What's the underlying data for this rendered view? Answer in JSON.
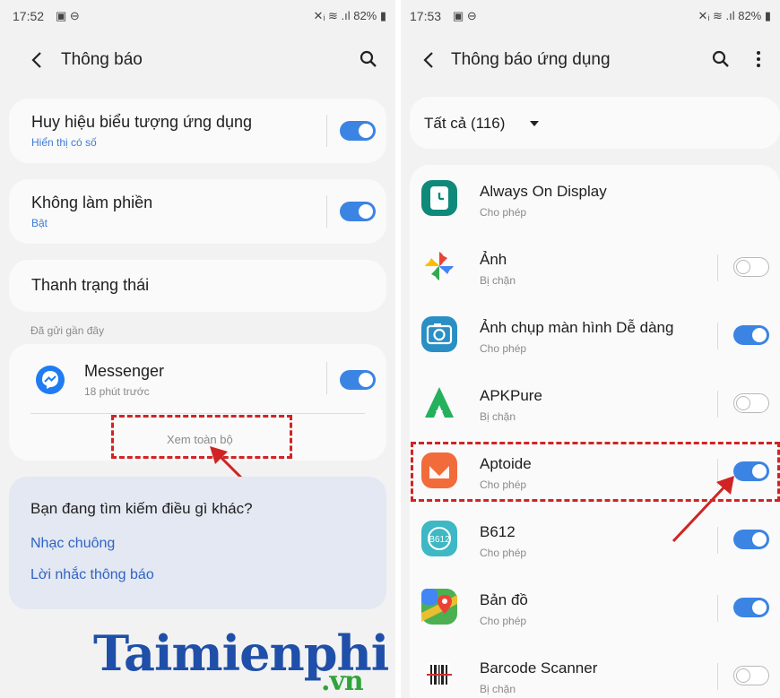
{
  "colors": {
    "accent": "#3b84e4",
    "link": "#2f63c4",
    "highlight": "#d02424",
    "toggle_off": "#b8b8b8"
  },
  "left": {
    "status": {
      "time": "17:52",
      "icons": "▣ ⊖",
      "right": "✕ᵢ ≋ .ıl 82% ▮"
    },
    "title": "Thông báo",
    "back_icon": "chevron-left-icon",
    "search_icon": "search-icon",
    "items": [
      {
        "title": "Huy hiệu biểu tượng ứng dụng",
        "subtitle": "Hiển thị có số",
        "on": true
      },
      {
        "title": "Không làm phiền",
        "subtitle": "Bật",
        "on": true
      },
      {
        "title": "Thanh trạng thái"
      }
    ],
    "section_header": "Đã gửi gần đây",
    "recent": {
      "name": "Messenger",
      "time": "18 phút trước",
      "on": true
    },
    "see_all": "Xem toàn bộ",
    "suggest": {
      "title": "Bạn đang tìm kiếm điều gì khác?",
      "links": [
        "Nhạc chuông",
        "Lời nhắc thông báo"
      ]
    },
    "watermark": {
      "brand": "Taimienphi",
      "domain": ".vn"
    }
  },
  "right": {
    "status": {
      "time": "17:53",
      "icons": "▣ ⊖",
      "right": "✕ᵢ ≋ .ıl 82% ▮"
    },
    "title": "Thông báo ứng dụng",
    "filter": "Tất cả (116)",
    "apps": [
      {
        "name": "Always On Display",
        "status": "Cho phép",
        "on": true,
        "show_toggle": false,
        "icon": "always-on-display-icon"
      },
      {
        "name": "Ảnh",
        "status": "Bị chặn",
        "on": false,
        "show_toggle": true,
        "icon": "photos-pinwheel-icon"
      },
      {
        "name": "Ảnh chụp màn hình Dễ dàng",
        "status": "Cho phép",
        "on": true,
        "show_toggle": true,
        "icon": "camera-icon"
      },
      {
        "name": "APKPure",
        "status": "Bị chặn",
        "on": false,
        "show_toggle": true,
        "icon": "apkpure-icon"
      },
      {
        "name": "Aptoide",
        "status": "Cho phép",
        "on": true,
        "show_toggle": true,
        "icon": "aptoide-icon"
      },
      {
        "name": "B612",
        "status": "Cho phép",
        "on": true,
        "show_toggle": true,
        "icon": "b612-icon"
      },
      {
        "name": "Bản đồ",
        "status": "Cho phép",
        "on": true,
        "show_toggle": true,
        "icon": "maps-icon"
      },
      {
        "name": "Barcode Scanner",
        "status": "Bị chặn",
        "on": false,
        "show_toggle": true,
        "icon": "barcode-icon"
      }
    ]
  }
}
